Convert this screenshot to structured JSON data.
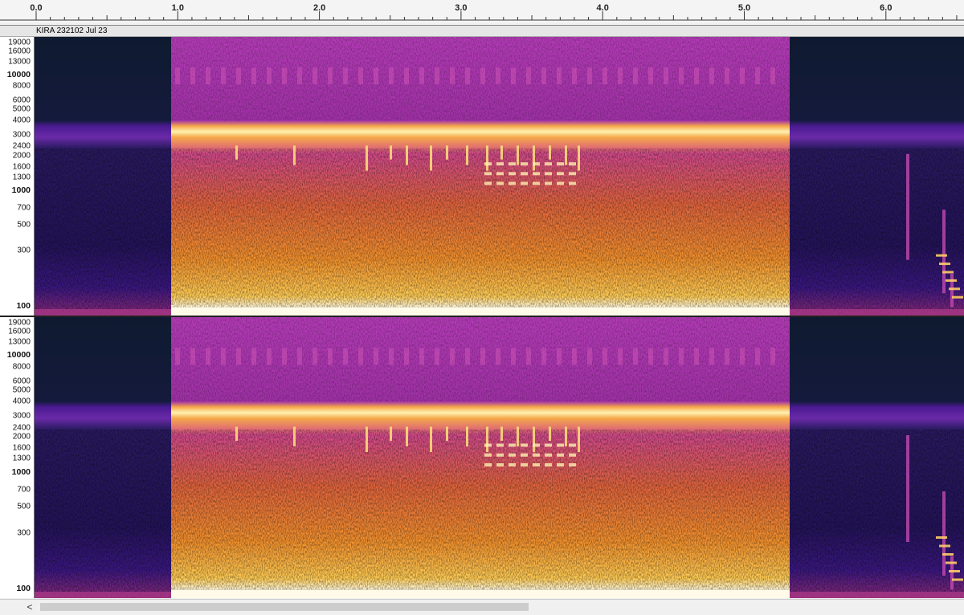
{
  "ruler": {
    "ticks": [
      {
        "label": "0.0",
        "t": 0.0
      },
      {
        "label": "1.0",
        "t": 1.0
      },
      {
        "label": "2.0",
        "t": 2.0
      },
      {
        "label": "3.0",
        "t": 3.0
      },
      {
        "label": "4.0",
        "t": 4.0
      },
      {
        "label": "5.0",
        "t": 5.0
      },
      {
        "label": "6.0",
        "t": 6.0
      }
    ]
  },
  "track": {
    "name": "KIRA 232102 Jul 23"
  },
  "frequency_axis": {
    "labels": [
      {
        "text": "19000",
        "hz": 19000,
        "major": false
      },
      {
        "text": "16000",
        "hz": 16000,
        "major": false
      },
      {
        "text": "13000",
        "hz": 13000,
        "major": false
      },
      {
        "text": "10000",
        "hz": 10000,
        "major": true
      },
      {
        "text": "8000",
        "hz": 8000,
        "major": false
      },
      {
        "text": "6000",
        "hz": 6000,
        "major": false
      },
      {
        "text": "5000",
        "hz": 5000,
        "major": false
      },
      {
        "text": "4000",
        "hz": 4000,
        "major": false
      },
      {
        "text": "3000",
        "hz": 3000,
        "major": false
      },
      {
        "text": "2400",
        "hz": 2400,
        "major": false
      },
      {
        "text": "2000",
        "hz": 2000,
        "major": false
      },
      {
        "text": "1600",
        "hz": 1600,
        "major": false
      },
      {
        "text": "1300",
        "hz": 1300,
        "major": false
      },
      {
        "text": "1000",
        "hz": 1000,
        "major": true
      },
      {
        "text": "700",
        "hz": 700,
        "major": false
      },
      {
        "text": "500",
        "hz": 500,
        "major": false
      },
      {
        "text": "300",
        "hz": 300,
        "major": false
      },
      {
        "text": "100",
        "hz": 100,
        "major": true
      }
    ]
  },
  "colors": {
    "spec_dark": "#0d1a2e",
    "spec_purple": "#7a1fa0",
    "spec_magenta": "#c23ab0",
    "spec_orange": "#f39a2a",
    "spec_yellow": "#ffe86a",
    "spec_white": "#fffbe8"
  },
  "scrollbar": {
    "left_arrow": "<"
  }
}
